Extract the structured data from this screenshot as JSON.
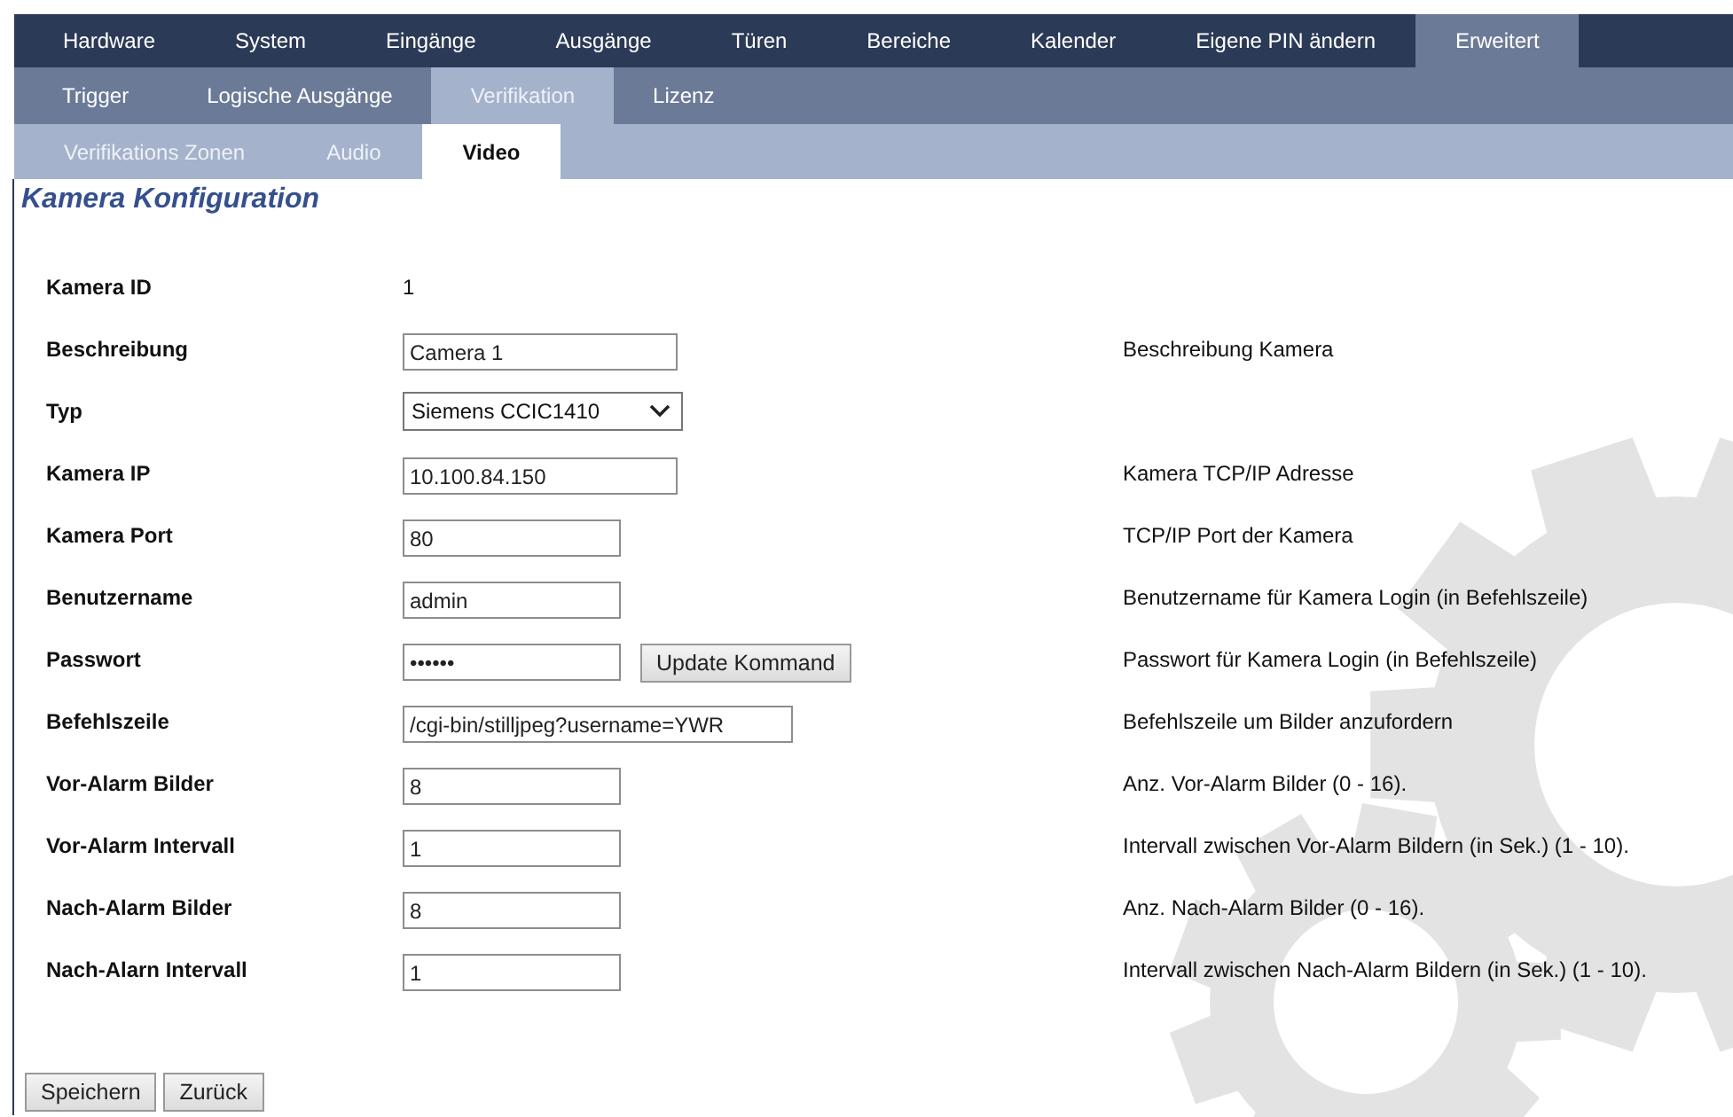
{
  "menus": [
    {
      "items": [
        {
          "label": "Hardware",
          "selected": false
        },
        {
          "label": "System",
          "selected": false
        },
        {
          "label": "Eingänge",
          "selected": false
        },
        {
          "label": "Ausgänge",
          "selected": false
        },
        {
          "label": "Türen",
          "selected": false
        },
        {
          "label": "Bereiche",
          "selected": false
        },
        {
          "label": "Kalender",
          "selected": false
        },
        {
          "label": "Eigene PIN ändern",
          "selected": false
        },
        {
          "label": "Erweitert",
          "selected": true
        }
      ]
    },
    {
      "items": [
        {
          "label": "Trigger",
          "selected": false
        },
        {
          "label": "Logische Ausgänge",
          "selected": false
        },
        {
          "label": "Verifikation",
          "selected": true
        },
        {
          "label": "Lizenz",
          "selected": false
        }
      ]
    },
    {
      "items": [
        {
          "label": "Verifikations Zonen",
          "selected": false
        },
        {
          "label": "Audio",
          "selected": false
        },
        {
          "label": "Video",
          "selected": true
        }
      ]
    }
  ],
  "page_title": "Kamera Konfiguration",
  "fields": [
    {
      "label": "Kamera ID",
      "kind": "value",
      "value": "1"
    },
    {
      "label": "Beschreibung",
      "kind": "text",
      "wide": true,
      "value": "Camera 1",
      "description": "Beschreibung Kamera"
    },
    {
      "label": "Typ",
      "kind": "select",
      "value": "Siemens CCIC1410"
    },
    {
      "label": "Kamera IP",
      "kind": "text",
      "wide": true,
      "value": "10.100.84.150",
      "description": "Kamera TCP/IP Adresse"
    },
    {
      "label": "Kamera Port",
      "kind": "text",
      "wide": false,
      "value": "80",
      "description": "TCP/IP Port der Kamera"
    },
    {
      "label": "Benutzername",
      "kind": "text",
      "wide": false,
      "value": "admin",
      "description": "Benutzername für Kamera Login (in Befehlszeile)"
    },
    {
      "label": "Passwort",
      "kind": "password",
      "wide": false,
      "value": "••••••",
      "button": "Update Kommand",
      "description": "Passwort für Kamera Login (in Befehlszeile)"
    },
    {
      "label": "Befehlszeile",
      "kind": "command",
      "value": "/cgi-bin/stilljpeg?username=YWR",
      "description": "Befehlszeile um Bilder anzufordern"
    },
    {
      "label": "Vor-Alarm Bilder",
      "kind": "text",
      "wide": false,
      "value": "8",
      "description": "Anz. Vor-Alarm Bilder (0 - 16)."
    },
    {
      "label": "Vor-Alarm Intervall",
      "kind": "text",
      "wide": false,
      "value": "1",
      "description": "Intervall zwischen Vor-Alarm Bildern (in Sek.) (1 - 10)."
    },
    {
      "label": "Nach-Alarm Bilder",
      "kind": "text",
      "wide": false,
      "value": "8",
      "description": "Anz. Nach-Alarm Bilder (0 - 16)."
    },
    {
      "label": "Nach-Alarn Intervall",
      "kind": "text",
      "wide": false,
      "value": "1",
      "description": "Intervall zwischen Nach-Alarm Bildern (in Sek.) (1 - 10)."
    }
  ],
  "buttons": [
    "Speichern",
    "Zurück"
  ]
}
